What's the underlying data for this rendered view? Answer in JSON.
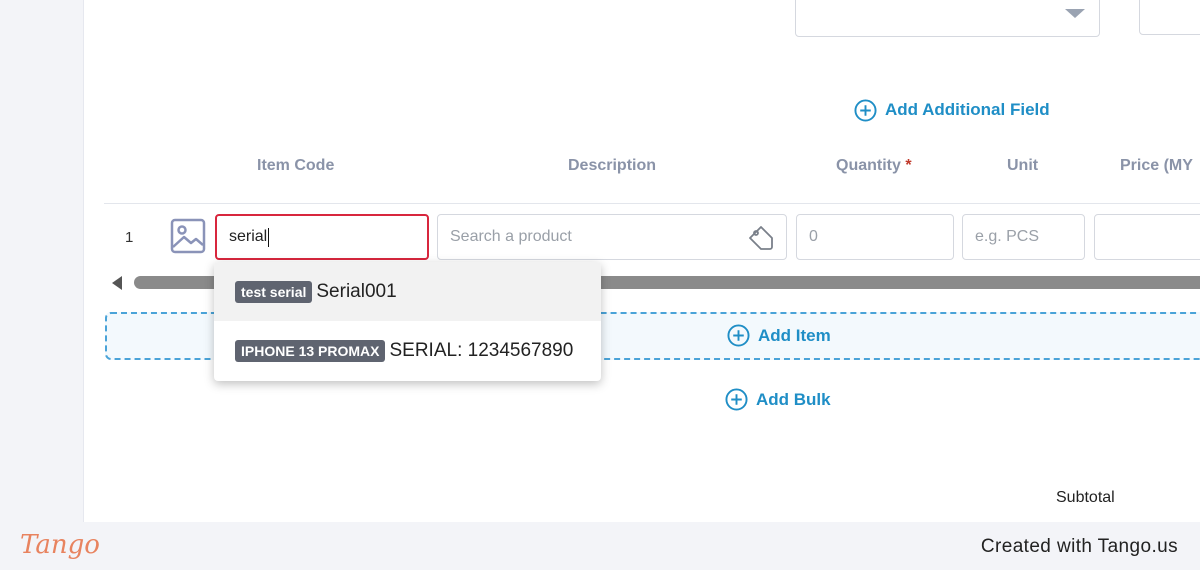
{
  "form": {
    "add_additional_field": "Add Additional Field"
  },
  "table": {
    "headers": {
      "item_code": "Item Code",
      "description": "Description",
      "quantity": "Quantity",
      "required_marker": "*",
      "unit": "Unit",
      "price": "Price (MY"
    },
    "row": {
      "number": "1",
      "item_code_value": "serial",
      "description_placeholder": "Search a product",
      "quantity_placeholder": "0",
      "unit_placeholder": "e.g. PCS"
    }
  },
  "dropdown": {
    "options": [
      {
        "badge": "test serial",
        "label": "Serial001"
      },
      {
        "badge": "IPHONE 13 PROMAX",
        "label": "SERIAL: 1234567890"
      }
    ]
  },
  "actions": {
    "add_item": "Add Item",
    "add_bulk": "Add Bulk"
  },
  "summary": {
    "subtotal_label": "Subtotal"
  },
  "footer": {
    "logo": "Tango",
    "created_with": "Created with Tango.us"
  },
  "colors": {
    "accent": "#1f8ec6",
    "active_border": "#d8263d",
    "required": "#c0392b",
    "badge_bg": "#5f6470"
  }
}
